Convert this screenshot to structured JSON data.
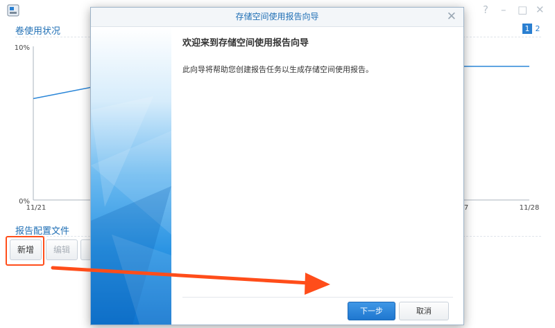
{
  "background_window": {
    "window_controls": [
      "?",
      "–",
      "□",
      "✕"
    ],
    "section_usage": "卷使用状况",
    "pager": [
      "1",
      "2"
    ],
    "chart_data": {
      "type": "line",
      "title": "",
      "y_ticks": [
        "10%",
        "0%"
      ],
      "x_ticks": [
        "11/21",
        "7",
        "11/28"
      ],
      "ylim": [
        0,
        10
      ],
      "series": [
        {
          "x": [
            "11/21",
            "11/22"
          ],
          "values": [
            6.6,
            7.5
          ]
        },
        {
          "x": [
            "11/27",
            "11/28"
          ],
          "values": [
            8.7,
            8.7
          ]
        }
      ],
      "line_color": "#2a86d8",
      "grid": false
    },
    "section_profiles": "报告配置文件",
    "buttons": {
      "add": "新增",
      "edit": "编辑"
    }
  },
  "dialog": {
    "title": "存储空间使用报告向导",
    "close_glyph": "✕",
    "heading": "欢迎来到存储空间使用报告向导",
    "description": "此向导将帮助您创建报告任务以生成存储空间使用报告。",
    "next_button": "下一步",
    "cancel_button": "取消"
  },
  "colors": {
    "accent": "#2a7fd1",
    "annotation": "#ff4d1a"
  }
}
